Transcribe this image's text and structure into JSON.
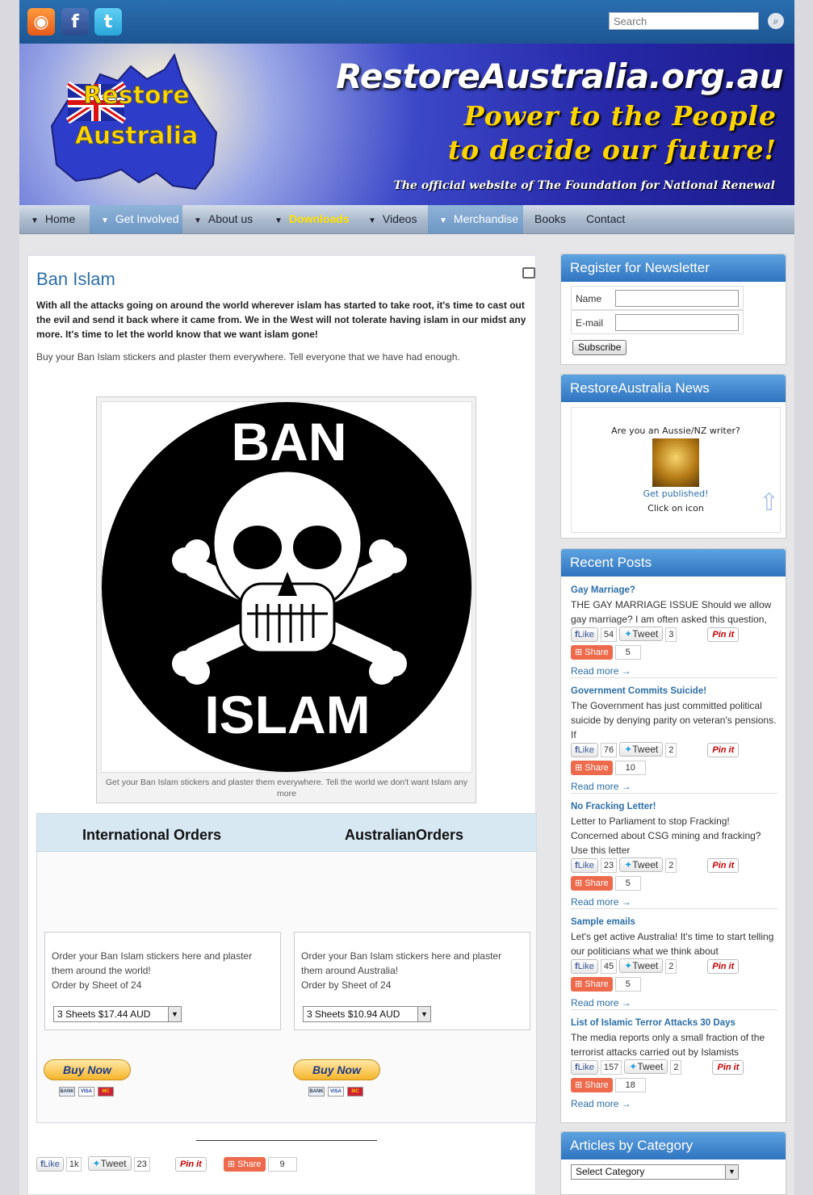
{
  "search": {
    "placeholder": "Search"
  },
  "banner": {
    "logo_line1": "Restore",
    "logo_line2": "Australia",
    "site_url": "RestoreAustralia.org.au",
    "tagline1": "Power to the People",
    "tagline2": "to decide our future!",
    "official": "The official website of The Foundation for National Renewal"
  },
  "nav": [
    "Home",
    "Get Involved",
    "About us",
    "Downloads",
    "Videos",
    "Merchandise",
    "Books",
    "Contact"
  ],
  "article": {
    "title": "Ban Islam",
    "intro": "With all the attacks going on around the world wherever islam has started to take root, it's time to cast out the evil and send it back where it came from. We in the West will not tolerate having islam in our midst any more. It's time to let the world know that we want islam gone!",
    "intro2": "Buy your Ban Islam stickers and plaster them everywhere. Tell everyone that we have had enough.",
    "sticker_top": "BAN",
    "sticker_bottom": "ISLAM",
    "caption": "Get your Ban Islam stickers and plaster them everywhere. Tell the world we don't want Islam any more"
  },
  "orders": {
    "intl_head": "International Orders",
    "aus_head": "AustralianOrders",
    "intl_text": "Order your Ban Islam stickers here and plaster them around the world!",
    "aus_text": "Order your Ban Islam stickers here and plaster them around Australia!",
    "by_sheet": "Order by Sheet of 24",
    "intl_option": "3 Sheets $17.44 AUD",
    "aus_option": "3 Sheets $10.94 AUD",
    "buy_label": "Buy Now",
    "card_bank": "BANK",
    "card_visa": "VISA",
    "card_mc": "MC"
  },
  "share": {
    "like": "Like",
    "tweet": "Tweet",
    "pin": "Pin it",
    "share": "Share",
    "like_count": "1k",
    "tweet_count": "23",
    "share_count": "9"
  },
  "newsletter": {
    "title": "Register for Newsletter",
    "name_label": "Name",
    "email_label": "E-mail",
    "subscribe": "Subscribe"
  },
  "news": {
    "title": "RestoreAustralia News",
    "line1": "Are you an Aussie/NZ writer?",
    "line2": "Get published!",
    "line3": "Click on icon"
  },
  "recent": {
    "title": "Recent Posts",
    "read_more": "Read more →",
    "posts": [
      {
        "title": "Gay Marriage?",
        "excerpt": "THE GAY MARRIAGE ISSUE Should we allow gay marriage? I am often asked this question,",
        "likes": "54",
        "tweets": "3",
        "shares": "5"
      },
      {
        "title": "Government Commits Suicide!",
        "excerpt": "The Government has just committed political suicide by denying parity on veteran's pensions.   If",
        "likes": "76",
        "tweets": "2",
        "shares": "10"
      },
      {
        "title": "No Fracking Letter!",
        "excerpt": "Letter to Parliament to stop Fracking! Concerned about CSG mining and fracking? Use this letter",
        "likes": "23",
        "tweets": "2",
        "shares": "5"
      },
      {
        "title": "Sample emails",
        "excerpt": "Let's get active Australia! It's time to start telling our politicians what we think about",
        "likes": "45",
        "tweets": "2",
        "shares": "5"
      },
      {
        "title": "List of Islamic Terror Attacks 30 Days",
        "excerpt": "The media reports only a small fraction of the terrorist attacks carried out by Islamists",
        "likes": "157",
        "tweets": "2",
        "shares": "18"
      }
    ]
  },
  "categories": {
    "title": "Articles by Category",
    "select": "Select Category"
  },
  "colors": {
    "accent": "#2b6ea8",
    "gold": "#ffd500",
    "nav_active": "#7aa2cd"
  }
}
